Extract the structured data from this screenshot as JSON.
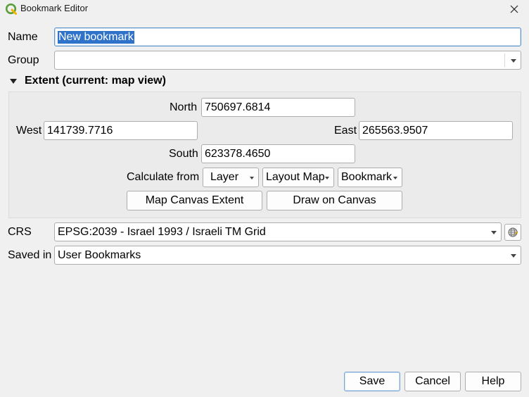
{
  "window": {
    "title": "Bookmark Editor"
  },
  "form": {
    "name_label": "Name",
    "name_value": "New bookmark",
    "group_label": "Group",
    "group_value": ""
  },
  "extent": {
    "header": "Extent (current: map view)",
    "north_label": "North",
    "north_value": "750697.6814",
    "west_label": "West",
    "west_value": "141739.7716",
    "east_label": "East",
    "east_value": "265563.9507",
    "south_label": "South",
    "south_value": "623378.4650",
    "calculate_from_label": "Calculate from",
    "calc_buttons": [
      "Layer",
      "Layout Map",
      "Bookmark"
    ],
    "map_canvas_extent": "Map Canvas Extent",
    "draw_on_canvas": "Draw on Canvas"
  },
  "crs": {
    "label": "CRS",
    "value": "EPSG:2039 - Israel 1993 / Israeli TM Grid"
  },
  "saved_in": {
    "label": "Saved in",
    "value": "User Bookmarks"
  },
  "footer": {
    "save": "Save",
    "cancel": "Cancel",
    "help": "Help"
  },
  "colors": {
    "selection": "#2f72c9",
    "focus_border": "#5e96c9",
    "qgis_green": "#5a9e3a"
  },
  "icons": {
    "app": "qgis-logo-icon",
    "close": "close-icon",
    "collapse": "collapse-triangle-icon",
    "crs_select": "globe-crs-icon"
  }
}
